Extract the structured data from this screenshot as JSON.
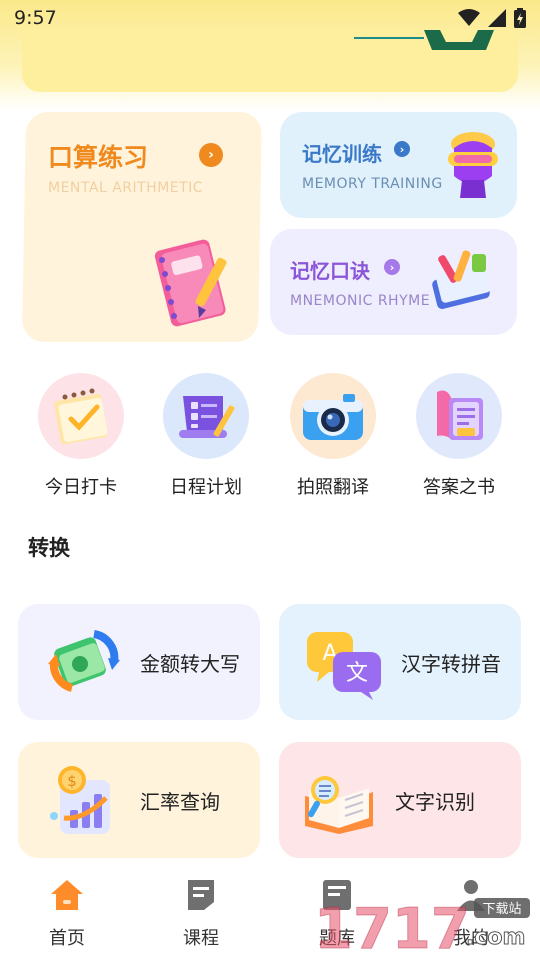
{
  "status_bar": {
    "time": "9:57"
  },
  "cards": {
    "mental": {
      "title": "口算练习",
      "subtitle": "MENTAL ARITHMETIC"
    },
    "memory": {
      "title": "记忆训练",
      "subtitle": "MEMORY TRAINING"
    },
    "mnemonic": {
      "title": "记忆口诀",
      "subtitle": "MNEMONIC RHYME"
    }
  },
  "tools": [
    {
      "label": "今日打卡",
      "icon": "checkin-calendar-icon"
    },
    {
      "label": "日程计划",
      "icon": "schedule-checklist-icon"
    },
    {
      "label": "拍照翻译",
      "icon": "camera-icon"
    },
    {
      "label": "答案之书",
      "icon": "answer-book-icon"
    }
  ],
  "section": {
    "title": "转换"
  },
  "conversions": [
    {
      "label": "金额转大写",
      "icon": "money-convert-icon"
    },
    {
      "label": "汉字转拼音",
      "icon": "chinese-pinyin-icon"
    },
    {
      "label": "汇率查询",
      "icon": "exchange-rate-icon"
    },
    {
      "label": "文字识别",
      "icon": "text-recognition-icon"
    }
  ],
  "nav": [
    {
      "label": "首页",
      "icon": "home-icon",
      "active": true
    },
    {
      "label": "课程",
      "icon": "course-icon",
      "active": false
    },
    {
      "label": "题库",
      "icon": "question-bank-icon",
      "active": false
    },
    {
      "label": "我的",
      "icon": "profile-icon",
      "active": false
    }
  ],
  "watermark": {
    "text": "1717",
    "suffix": ".com",
    "tag": "下载站"
  },
  "colors": {
    "accent_orange": "#f08a1e",
    "memory_blue": "#3a78c8",
    "mnemonic_purple": "#8a55d6"
  }
}
